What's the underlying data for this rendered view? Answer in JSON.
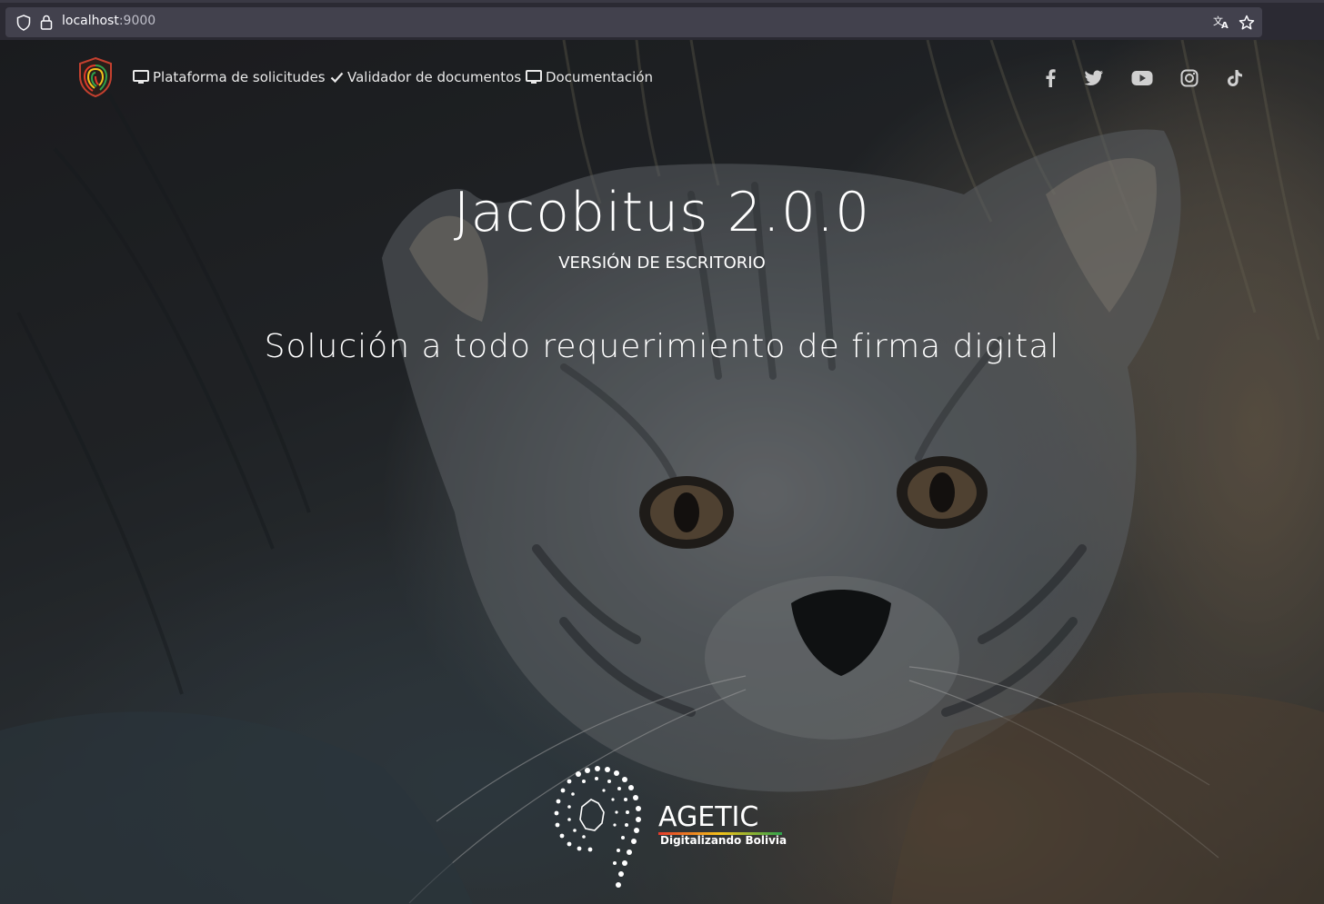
{
  "browser": {
    "url_host": "localhost",
    "url_port": ":9000"
  },
  "nav": {
    "items": [
      {
        "label": "Plataforma de solicitudes",
        "icon": "monitor-icon"
      },
      {
        "label": "Validador de documentos",
        "icon": "check-icon"
      },
      {
        "label": "Documentación",
        "icon": "monitor-icon"
      }
    ],
    "social": [
      "facebook-icon",
      "twitter-icon",
      "youtube-icon",
      "instagram-icon",
      "tiktok-icon"
    ]
  },
  "hero": {
    "title": "Jacobitus 2.0.0",
    "subtitle": "VERSIÓN DE ESCRITORIO",
    "tagline": "Solución a todo requerimiento de firma digital"
  },
  "footer_logo": {
    "name": "AGETIC",
    "slogan": "Digitalizando Bolivia"
  },
  "colors": {
    "browser_bg": "#2b2a33",
    "url_field": "#42414d",
    "text": "#ffffff",
    "bolivia_red": "#e23a2b",
    "bolivia_yellow": "#f3c21a",
    "bolivia_green": "#2ea14b"
  }
}
